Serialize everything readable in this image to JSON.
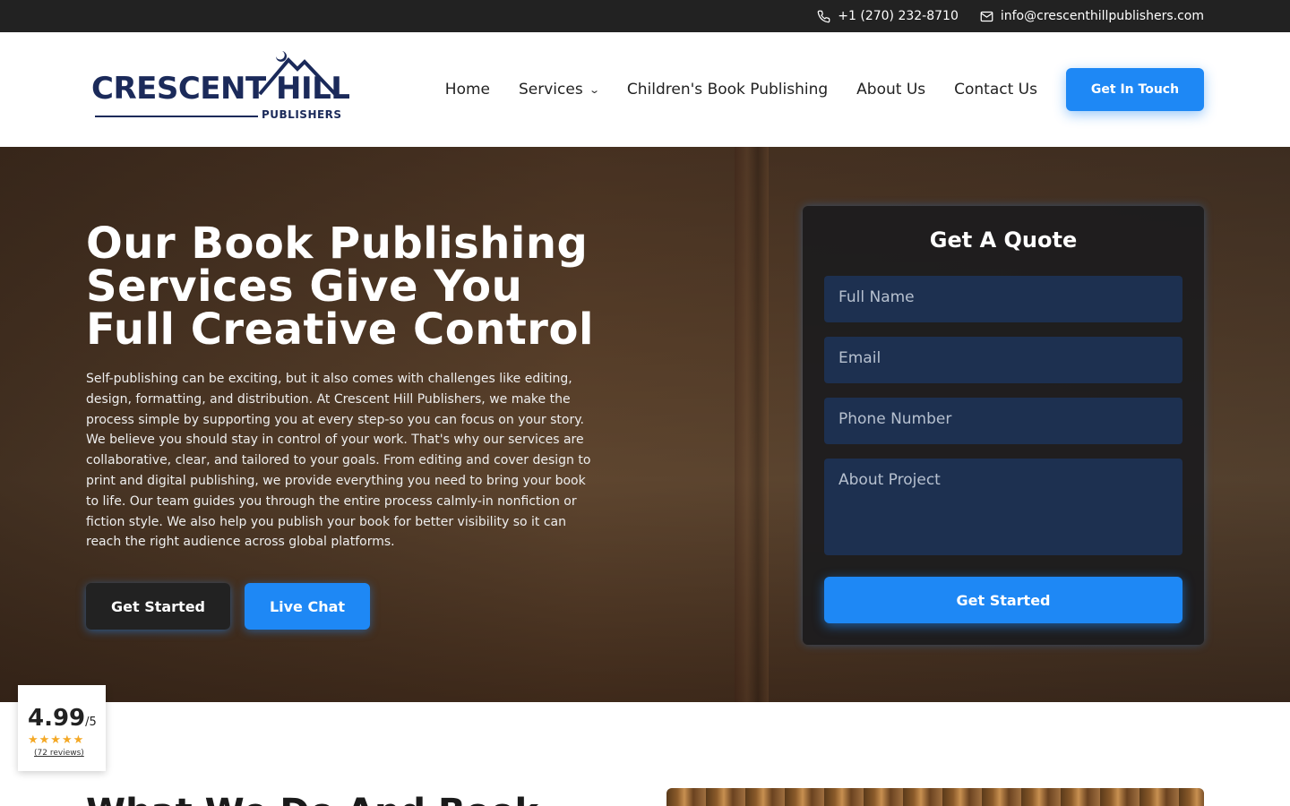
{
  "topbar": {
    "phone": "+1 (270) 232-8710",
    "email": "info@crescenthillpublishers.com",
    "phone_icon": "phone-icon",
    "email_icon": "mail-icon"
  },
  "header": {
    "logo_main": "CRESCENT HILL",
    "logo_sub": "PUBLISHERS",
    "nav": {
      "home": "Home",
      "services": "Services",
      "childrens": "Children's Book Publishing",
      "about": "About Us",
      "contact": "Contact Us"
    },
    "cta": "Get In Touch"
  },
  "hero": {
    "title_line1": "Our Book Publishing",
    "title_line2": "Services Give You",
    "title_line3": "Full Creative Control",
    "description": "Self-publishing can be exciting, but it also comes with challenges like editing, design, formatting, and distribution. At Crescent Hill Publishers, we make the process simple by supporting you at every step-so you can focus on your story. We believe you should stay in control of your work. That's why our services are collaborative, clear, and tailored to your goals. From editing and cover design to print and digital publishing, we provide everything you need to bring your book to life. Our team guides you through the entire process calmly-in nonfiction or fiction style. We also help you publish your book for better visibility so it can reach the right audience across global platforms.",
    "btn_primary": "Get Started",
    "btn_secondary": "Live Chat"
  },
  "quote_form": {
    "title": "Get A Quote",
    "full_name_placeholder": "Full Name",
    "email_placeholder": "Email",
    "phone_placeholder": "Phone Number",
    "project_placeholder": "About Project",
    "submit": "Get Started"
  },
  "rating": {
    "score": "4.99",
    "out_of": "/5",
    "stars": "★★★★★",
    "reviews": "(72 reviews)"
  },
  "next_section": {
    "heading_peek": "What We Do And Book"
  },
  "colors": {
    "accent": "#1e88f5",
    "topbar_bg": "#222222",
    "logo_navy": "#1b2a5a"
  }
}
